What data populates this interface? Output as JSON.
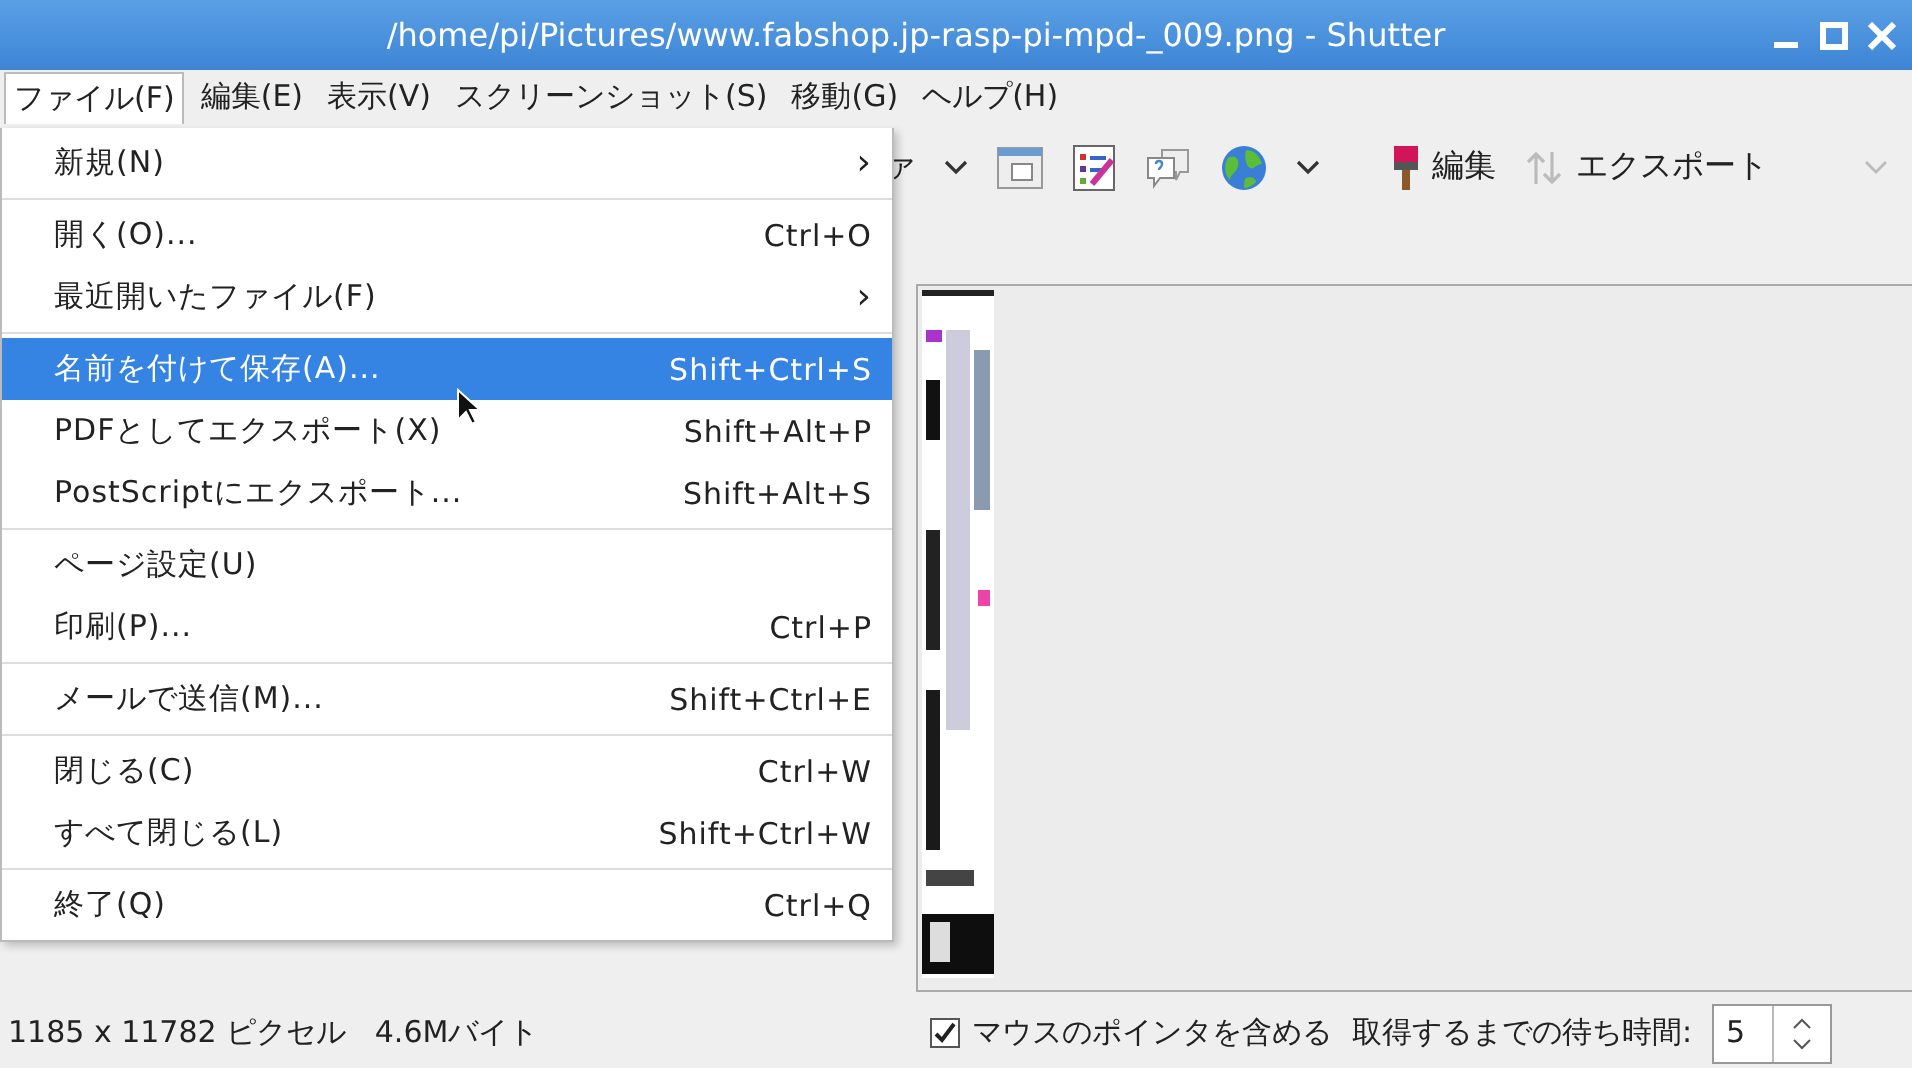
{
  "window": {
    "title": "/home/pi/Pictures/www.fabshop.jp-rasp-pi-mpd-_009.png - Shutter"
  },
  "menubar": [
    {
      "label": "ファイル(F)",
      "selected": true
    },
    {
      "label": "編集(E)",
      "selected": false
    },
    {
      "label": "表示(V)",
      "selected": false
    },
    {
      "label": "スクリーンショット(S)",
      "selected": false
    },
    {
      "label": "移動(G)",
      "selected": false
    },
    {
      "label": "ヘルプ(H)",
      "selected": false
    }
  ],
  "menu": {
    "groups": [
      [
        {
          "label": "新規(N)",
          "arrow": "›",
          "selected": false
        }
      ],
      [
        {
          "label": "開く(O)...",
          "shortcut": "Ctrl+O",
          "selected": false
        },
        {
          "label": "最近開いたファイル(F)",
          "arrow": "›",
          "selected": false
        }
      ],
      [
        {
          "label": "名前を付けて保存(A)...",
          "shortcut": "Shift+Ctrl+S",
          "selected": true
        },
        {
          "label": "PDFとしてエクスポート(X)",
          "shortcut": "Shift+Alt+P",
          "selected": false
        },
        {
          "label": "PostScriptにエクスポート...",
          "shortcut": "Shift+Alt+S",
          "selected": false
        }
      ],
      [
        {
          "label": "ページ設定(U)",
          "selected": false
        },
        {
          "label": "印刷(P)...",
          "shortcut": "Ctrl+P",
          "selected": false
        }
      ],
      [
        {
          "label": "メールで送信(M)...",
          "shortcut": "Shift+Ctrl+E",
          "selected": false
        }
      ],
      [
        {
          "label": "閉じる(C)",
          "shortcut": "Ctrl+W",
          "selected": false
        },
        {
          "label": "すべて閉じる(L)",
          "shortcut": "Shift+Ctrl+W",
          "selected": false
        }
      ],
      [
        {
          "label": "終了(Q)",
          "shortcut": "Ctrl+Q",
          "selected": false
        }
      ]
    ]
  },
  "toolbar": {
    "cut_label": "ァ",
    "edit_label": "編集",
    "export_label": "エクスポート"
  },
  "status_bar": {
    "info": "1185 x 11782 ピクセル   4.6Mバイト",
    "include_pointer": {
      "label": "マウスのポインタを含める",
      "checked": true
    },
    "delay_label": "取得するまでの待ち時間:",
    "delay_value": "5"
  }
}
